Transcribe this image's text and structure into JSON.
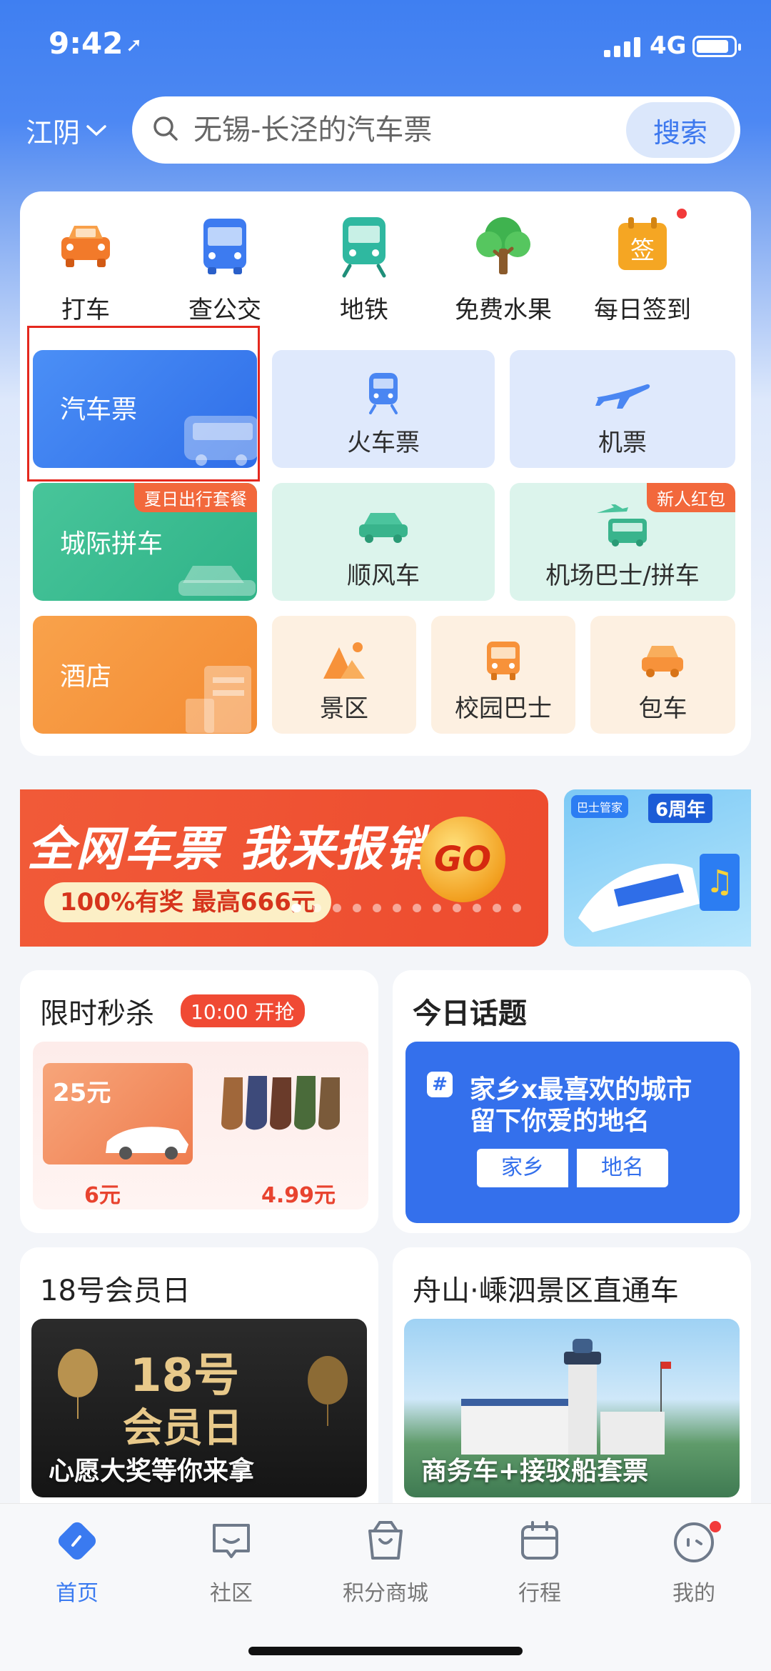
{
  "status_bar": {
    "time": "9:42",
    "network": "4G"
  },
  "header": {
    "city": "江阴",
    "search_placeholder": "无锡-长泾的汽车票",
    "search_button": "搜索"
  },
  "quick_icons": [
    {
      "label": "打车",
      "icon": "taxi-icon"
    },
    {
      "label": "查公交",
      "icon": "bus-icon"
    },
    {
      "label": "地铁",
      "icon": "metro-icon"
    },
    {
      "label": "免费水果",
      "icon": "tree-icon"
    },
    {
      "label": "每日签到",
      "icon": "checkin-icon",
      "badge_dot": true
    }
  ],
  "services": {
    "bus_ticket": "汽车票",
    "train_ticket": "火车票",
    "flight_ticket": "机票",
    "intercity": "城际拼车",
    "intercity_tag": "夏日出行套餐",
    "ride_share": "顺风车",
    "airport_bus": "机场巴士/拼车",
    "airport_tag": "新人红包",
    "hotel": "酒店",
    "scenic": "景区",
    "campus_bus": "校园巴士",
    "charter": "包车"
  },
  "banner": {
    "title": "全网车票 我来报销",
    "subtitle": "100%有奖 最高666元",
    "go": "GO",
    "side_brand": "巴士管家",
    "side_year": "6周年"
  },
  "flash_sale": {
    "title": "限时秒杀",
    "badge": "10:00 开抢",
    "coupon_amount": "25元",
    "items": [
      {
        "price": "6元"
      },
      {
        "price": "4.99元"
      }
    ]
  },
  "topic": {
    "title": "今日话题",
    "line1": "家乡x最喜欢的城市",
    "line2": "留下你爱的地名",
    "pill_left": "家乡",
    "pill_right": "地名"
  },
  "member_day": {
    "title": "18号会员日",
    "big": "18号",
    "big2": "会员日",
    "caption": "心愿大奖等你来拿"
  },
  "scenic_bus": {
    "title": "舟山·嵊泗景区直通车",
    "caption": "商务车+接驳船套票"
  },
  "tabbar": [
    {
      "label": "首页",
      "active": true
    },
    {
      "label": "社区"
    },
    {
      "label": "积分商城"
    },
    {
      "label": "行程"
    },
    {
      "label": "我的",
      "badge_dot": true
    }
  ],
  "colors": {
    "primary": "#3a7af0",
    "accent_red": "#f04a34"
  }
}
